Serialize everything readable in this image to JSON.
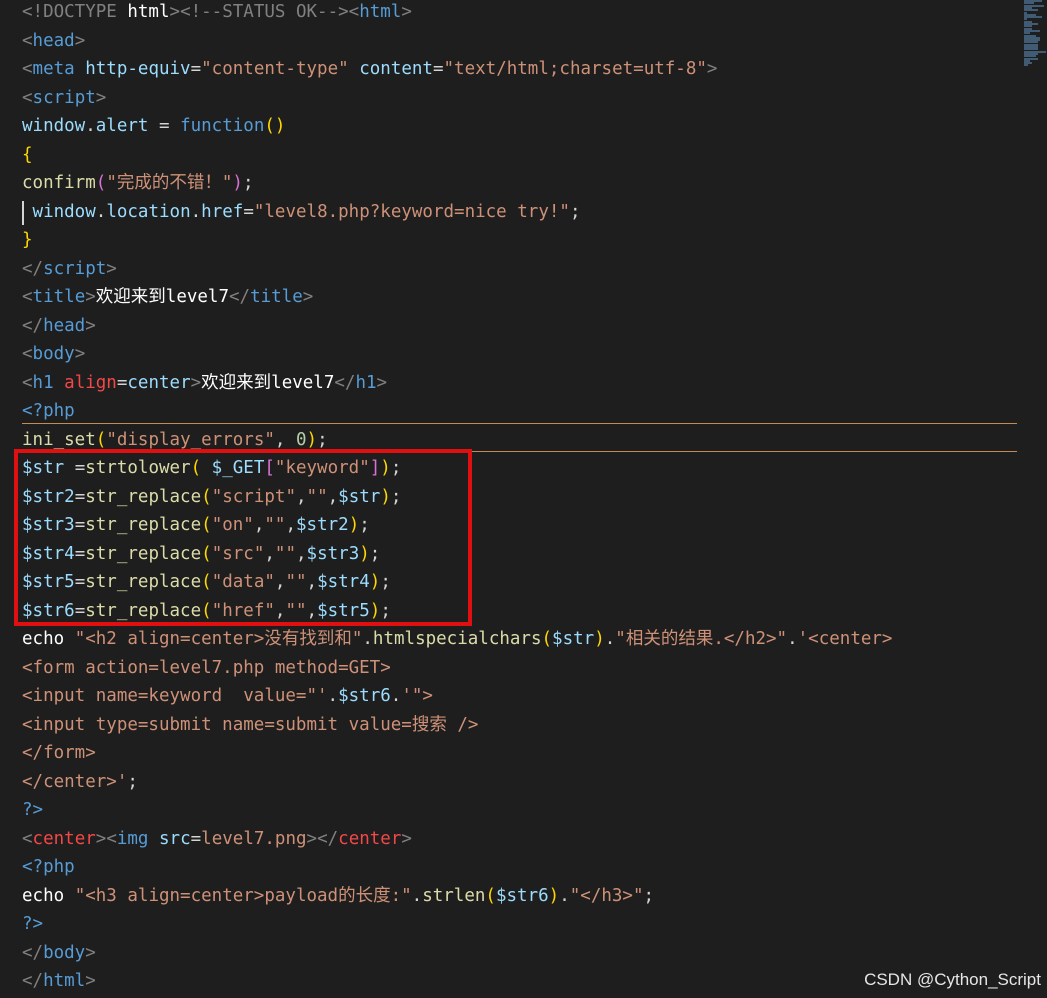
{
  "editor": {
    "lines": [
      [
        {
          "t": "<!DOCTYPE ",
          "c": "t-tag"
        },
        {
          "t": "html",
          "c": "t-white"
        },
        {
          "t": ">",
          "c": "t-tag"
        },
        {
          "t": "<!--STATUS OK-->",
          "c": "t-tag"
        },
        {
          "t": "<",
          "c": "t-tag"
        },
        {
          "t": "html",
          "c": "t-kw"
        },
        {
          "t": ">",
          "c": "t-tag"
        }
      ],
      [
        {
          "t": "<",
          "c": "t-tag"
        },
        {
          "t": "head",
          "c": "t-kw"
        },
        {
          "t": ">",
          "c": "t-tag"
        }
      ],
      [
        {
          "t": "<",
          "c": "t-tag"
        },
        {
          "t": "meta ",
          "c": "t-kw"
        },
        {
          "t": "http-equiv",
          "c": "t-attr"
        },
        {
          "t": "=",
          "c": "t-op"
        },
        {
          "t": "\"content-type\"",
          "c": "t-str"
        },
        {
          "t": " ",
          "c": "t-op"
        },
        {
          "t": "content",
          "c": "t-attr"
        },
        {
          "t": "=",
          "c": "t-op"
        },
        {
          "t": "\"text/html;charset=utf-8\"",
          "c": "t-str"
        },
        {
          "t": ">",
          "c": "t-tag"
        }
      ],
      [
        {
          "t": "<",
          "c": "t-tag"
        },
        {
          "t": "script",
          "c": "t-kw"
        },
        {
          "t": ">",
          "c": "t-tag"
        }
      ],
      [
        {
          "t": "window",
          "c": "t-var"
        },
        {
          "t": ".",
          "c": "t-op"
        },
        {
          "t": "alert",
          "c": "t-var"
        },
        {
          "t": " = ",
          "c": "t-op"
        },
        {
          "t": "function",
          "c": "t-kw"
        },
        {
          "t": "()",
          "c": "t-brk"
        }
      ],
      [
        {
          "t": "{",
          "c": "t-brk"
        }
      ],
      [
        {
          "t": "confirm",
          "c": "t-fn"
        },
        {
          "t": "(",
          "c": "t-brk2"
        },
        {
          "t": "\"完成的不错！\"",
          "c": "t-str"
        },
        {
          "t": ")",
          "c": "t-brk2"
        },
        {
          "t": ";",
          "c": "t-op"
        }
      ],
      [
        {
          "t": " window",
          "c": "t-var"
        },
        {
          "t": ".",
          "c": "t-op"
        },
        {
          "t": "location",
          "c": "t-var"
        },
        {
          "t": ".",
          "c": "t-op"
        },
        {
          "t": "href",
          "c": "t-var"
        },
        {
          "t": "=",
          "c": "t-op"
        },
        {
          "t": "\"level8.php?keyword=nice try!\"",
          "c": "t-str"
        },
        {
          "t": ";",
          "c": "t-op"
        }
      ],
      [
        {
          "t": "}",
          "c": "t-brk"
        }
      ],
      [
        {
          "t": "</",
          "c": "t-tag"
        },
        {
          "t": "script",
          "c": "t-kw"
        },
        {
          "t": ">",
          "c": "t-tag"
        }
      ],
      [
        {
          "t": "<",
          "c": "t-tag"
        },
        {
          "t": "title",
          "c": "t-kw"
        },
        {
          "t": ">",
          "c": "t-tag"
        },
        {
          "t": "欢迎来到level7",
          "c": "t-white"
        },
        {
          "t": "</",
          "c": "t-tag"
        },
        {
          "t": "title",
          "c": "t-kw"
        },
        {
          "t": ">",
          "c": "t-tag"
        }
      ],
      [
        {
          "t": "</",
          "c": "t-tag"
        },
        {
          "t": "head",
          "c": "t-kw"
        },
        {
          "t": ">",
          "c": "t-tag"
        }
      ],
      [
        {
          "t": "<",
          "c": "t-tag"
        },
        {
          "t": "body",
          "c": "t-kw"
        },
        {
          "t": ">",
          "c": "t-tag"
        }
      ],
      [
        {
          "t": "<",
          "c": "t-tag"
        },
        {
          "t": "h1 ",
          "c": "t-kw"
        },
        {
          "t": "align",
          "c": "t-red"
        },
        {
          "t": "=",
          "c": "t-op"
        },
        {
          "t": "center",
          "c": "t-attr"
        },
        {
          "t": ">",
          "c": "t-tag"
        },
        {
          "t": "欢迎来到level7",
          "c": "t-white"
        },
        {
          "t": "</",
          "c": "t-tag"
        },
        {
          "t": "h1",
          "c": "t-kw"
        },
        {
          "t": ">",
          "c": "t-tag"
        }
      ],
      [
        {
          "t": "<?php",
          "c": "t-php"
        }
      ],
      [
        {
          "t": "ini_set",
          "c": "t-fn"
        },
        {
          "t": "(",
          "c": "t-brk"
        },
        {
          "t": "\"display_errors\"",
          "c": "t-str"
        },
        {
          "t": ", ",
          "c": "t-op"
        },
        {
          "t": "0",
          "c": "t-num"
        },
        {
          "t": ")",
          "c": "t-brk"
        },
        {
          "t": ";",
          "c": "t-op"
        }
      ],
      [
        {
          "t": "$str",
          "c": "t-var"
        },
        {
          "t": " =",
          "c": "t-op"
        },
        {
          "t": "strtolower",
          "c": "t-fn"
        },
        {
          "t": "( ",
          "c": "t-brk"
        },
        {
          "t": "$_GET",
          "c": "t-var"
        },
        {
          "t": "[",
          "c": "t-brk2"
        },
        {
          "t": "\"keyword\"",
          "c": "t-str"
        },
        {
          "t": "]",
          "c": "t-brk2"
        },
        {
          "t": ")",
          "c": "t-brk"
        },
        {
          "t": ";",
          "c": "t-op"
        }
      ],
      [
        {
          "t": "$str2",
          "c": "t-var"
        },
        {
          "t": "=",
          "c": "t-op"
        },
        {
          "t": "str_replace",
          "c": "t-fn"
        },
        {
          "t": "(",
          "c": "t-brk"
        },
        {
          "t": "\"script\"",
          "c": "t-str"
        },
        {
          "t": ",",
          "c": "t-op"
        },
        {
          "t": "\"\"",
          "c": "t-str"
        },
        {
          "t": ",",
          "c": "t-op"
        },
        {
          "t": "$str",
          "c": "t-var"
        },
        {
          "t": ")",
          "c": "t-brk"
        },
        {
          "t": ";",
          "c": "t-op"
        }
      ],
      [
        {
          "t": "$str3",
          "c": "t-var"
        },
        {
          "t": "=",
          "c": "t-op"
        },
        {
          "t": "str_replace",
          "c": "t-fn"
        },
        {
          "t": "(",
          "c": "t-brk"
        },
        {
          "t": "\"on\"",
          "c": "t-str"
        },
        {
          "t": ",",
          "c": "t-op"
        },
        {
          "t": "\"\"",
          "c": "t-str"
        },
        {
          "t": ",",
          "c": "t-op"
        },
        {
          "t": "$str2",
          "c": "t-var"
        },
        {
          "t": ")",
          "c": "t-brk"
        },
        {
          "t": ";",
          "c": "t-op"
        }
      ],
      [
        {
          "t": "$str4",
          "c": "t-var"
        },
        {
          "t": "=",
          "c": "t-op"
        },
        {
          "t": "str_replace",
          "c": "t-fn"
        },
        {
          "t": "(",
          "c": "t-brk"
        },
        {
          "t": "\"src\"",
          "c": "t-str"
        },
        {
          "t": ",",
          "c": "t-op"
        },
        {
          "t": "\"\"",
          "c": "t-str"
        },
        {
          "t": ",",
          "c": "t-op"
        },
        {
          "t": "$str3",
          "c": "t-var"
        },
        {
          "t": ")",
          "c": "t-brk"
        },
        {
          "t": ";",
          "c": "t-op"
        }
      ],
      [
        {
          "t": "$str5",
          "c": "t-var"
        },
        {
          "t": "=",
          "c": "t-op"
        },
        {
          "t": "str_replace",
          "c": "t-fn"
        },
        {
          "t": "(",
          "c": "t-brk"
        },
        {
          "t": "\"data\"",
          "c": "t-str"
        },
        {
          "t": ",",
          "c": "t-op"
        },
        {
          "t": "\"\"",
          "c": "t-str"
        },
        {
          "t": ",",
          "c": "t-op"
        },
        {
          "t": "$str4",
          "c": "t-var"
        },
        {
          "t": ")",
          "c": "t-brk"
        },
        {
          "t": ";",
          "c": "t-op"
        }
      ],
      [
        {
          "t": "$str6",
          "c": "t-var"
        },
        {
          "t": "=",
          "c": "t-op"
        },
        {
          "t": "str_replace",
          "c": "t-fn"
        },
        {
          "t": "(",
          "c": "t-brk"
        },
        {
          "t": "\"href\"",
          "c": "t-str"
        },
        {
          "t": ",",
          "c": "t-op"
        },
        {
          "t": "\"\"",
          "c": "t-str"
        },
        {
          "t": ",",
          "c": "t-op"
        },
        {
          "t": "$str5",
          "c": "t-var"
        },
        {
          "t": ")",
          "c": "t-brk"
        },
        {
          "t": ";",
          "c": "t-op"
        }
      ],
      [
        {
          "t": "echo ",
          "c": "t-white"
        },
        {
          "t": "\"<h2 align=center>没有找到和\"",
          "c": "t-str"
        },
        {
          "t": ".",
          "c": "t-op"
        },
        {
          "t": "htmlspecialchars",
          "c": "t-fn"
        },
        {
          "t": "(",
          "c": "t-brk"
        },
        {
          "t": "$str",
          "c": "t-var"
        },
        {
          "t": ")",
          "c": "t-brk"
        },
        {
          "t": ".",
          "c": "t-op"
        },
        {
          "t": "\"相关的结果.</h2>\"",
          "c": "t-str"
        },
        {
          "t": ".",
          "c": "t-op"
        },
        {
          "t": "'<center>",
          "c": "t-str"
        }
      ],
      [
        {
          "t": "<form action=level7.php method=GET>",
          "c": "t-str"
        }
      ],
      [
        {
          "t": "<input name=keyword  value=\"'",
          "c": "t-str"
        },
        {
          "t": ".",
          "c": "t-op"
        },
        {
          "t": "$str6",
          "c": "t-var"
        },
        {
          "t": ".",
          "c": "t-op"
        },
        {
          "t": "'\">",
          "c": "t-str"
        }
      ],
      [
        {
          "t": "<input type=submit name=submit value=搜索 />",
          "c": "t-str"
        }
      ],
      [
        {
          "t": "</form>",
          "c": "t-str"
        }
      ],
      [
        {
          "t": "</center>'",
          "c": "t-str"
        },
        {
          "t": ";",
          "c": "t-op"
        }
      ],
      [
        {
          "t": "?>",
          "c": "t-php"
        }
      ],
      [
        {
          "t": "<",
          "c": "t-tag"
        },
        {
          "t": "center",
          "c": "t-red"
        },
        {
          "t": ">",
          "c": "t-tag"
        },
        {
          "t": "<",
          "c": "t-tag"
        },
        {
          "t": "img ",
          "c": "t-kw"
        },
        {
          "t": "src",
          "c": "t-attr"
        },
        {
          "t": "=",
          "c": "t-op"
        },
        {
          "t": "level7.png",
          "c": "t-str"
        },
        {
          "t": ">",
          "c": "t-tag"
        },
        {
          "t": "</",
          "c": "t-tag"
        },
        {
          "t": "center",
          "c": "t-red"
        },
        {
          "t": ">",
          "c": "t-tag"
        }
      ],
      [
        {
          "t": "<?php",
          "c": "t-php"
        }
      ],
      [
        {
          "t": "echo ",
          "c": "t-white"
        },
        {
          "t": "\"<h3 align=center>payload的长度:\"",
          "c": "t-str"
        },
        {
          "t": ".",
          "c": "t-op"
        },
        {
          "t": "strlen",
          "c": "t-fn"
        },
        {
          "t": "(",
          "c": "t-brk"
        },
        {
          "t": "$str6",
          "c": "t-var"
        },
        {
          "t": ")",
          "c": "t-brk"
        },
        {
          "t": ".",
          "c": "t-op"
        },
        {
          "t": "\"</h3>\"",
          "c": "t-str"
        },
        {
          "t": ";",
          "c": "t-op"
        }
      ],
      [
        {
          "t": "?>",
          "c": "t-php"
        }
      ],
      [
        {
          "t": "</",
          "c": "t-tag"
        },
        {
          "t": "body",
          "c": "t-kw"
        },
        {
          "t": ">",
          "c": "t-tag"
        }
      ],
      [
        {
          "t": "</",
          "c": "t-tag"
        },
        {
          "t": "html",
          "c": "t-kw"
        },
        {
          "t": ">",
          "c": "t-tag"
        }
      ]
    ]
  },
  "colors": {
    "background": "#1e1e1e",
    "highlight_box": "#e01010",
    "current_line_border": "#e0a060"
  },
  "watermark": "CSDN @Cython_Script"
}
